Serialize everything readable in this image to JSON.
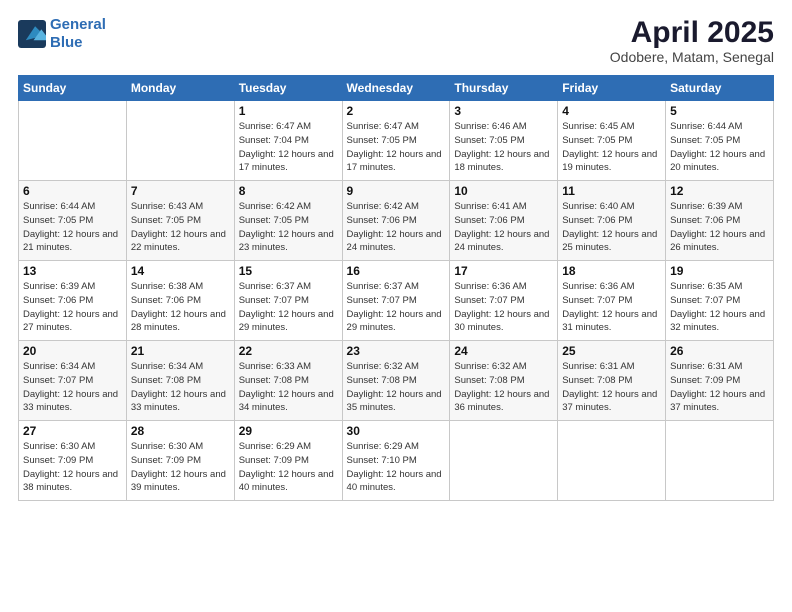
{
  "logo": {
    "line1": "General",
    "line2": "Blue"
  },
  "title": "April 2025",
  "subtitle": "Odobere, Matam, Senegal",
  "weekdays": [
    "Sunday",
    "Monday",
    "Tuesday",
    "Wednesday",
    "Thursday",
    "Friday",
    "Saturday"
  ],
  "weeks": [
    [
      null,
      null,
      {
        "day": "1",
        "sunrise": "6:47 AM",
        "sunset": "7:04 PM",
        "daylight": "12 hours and 17 minutes."
      },
      {
        "day": "2",
        "sunrise": "6:47 AM",
        "sunset": "7:05 PM",
        "daylight": "12 hours and 17 minutes."
      },
      {
        "day": "3",
        "sunrise": "6:46 AM",
        "sunset": "7:05 PM",
        "daylight": "12 hours and 18 minutes."
      },
      {
        "day": "4",
        "sunrise": "6:45 AM",
        "sunset": "7:05 PM",
        "daylight": "12 hours and 19 minutes."
      },
      {
        "day": "5",
        "sunrise": "6:44 AM",
        "sunset": "7:05 PM",
        "daylight": "12 hours and 20 minutes."
      }
    ],
    [
      {
        "day": "6",
        "sunrise": "6:44 AM",
        "sunset": "7:05 PM",
        "daylight": "12 hours and 21 minutes."
      },
      {
        "day": "7",
        "sunrise": "6:43 AM",
        "sunset": "7:05 PM",
        "daylight": "12 hours and 22 minutes."
      },
      {
        "day": "8",
        "sunrise": "6:42 AM",
        "sunset": "7:05 PM",
        "daylight": "12 hours and 23 minutes."
      },
      {
        "day": "9",
        "sunrise": "6:42 AM",
        "sunset": "7:06 PM",
        "daylight": "12 hours and 24 minutes."
      },
      {
        "day": "10",
        "sunrise": "6:41 AM",
        "sunset": "7:06 PM",
        "daylight": "12 hours and 24 minutes."
      },
      {
        "day": "11",
        "sunrise": "6:40 AM",
        "sunset": "7:06 PM",
        "daylight": "12 hours and 25 minutes."
      },
      {
        "day": "12",
        "sunrise": "6:39 AM",
        "sunset": "7:06 PM",
        "daylight": "12 hours and 26 minutes."
      }
    ],
    [
      {
        "day": "13",
        "sunrise": "6:39 AM",
        "sunset": "7:06 PM",
        "daylight": "12 hours and 27 minutes."
      },
      {
        "day": "14",
        "sunrise": "6:38 AM",
        "sunset": "7:06 PM",
        "daylight": "12 hours and 28 minutes."
      },
      {
        "day": "15",
        "sunrise": "6:37 AM",
        "sunset": "7:07 PM",
        "daylight": "12 hours and 29 minutes."
      },
      {
        "day": "16",
        "sunrise": "6:37 AM",
        "sunset": "7:07 PM",
        "daylight": "12 hours and 29 minutes."
      },
      {
        "day": "17",
        "sunrise": "6:36 AM",
        "sunset": "7:07 PM",
        "daylight": "12 hours and 30 minutes."
      },
      {
        "day": "18",
        "sunrise": "6:36 AM",
        "sunset": "7:07 PM",
        "daylight": "12 hours and 31 minutes."
      },
      {
        "day": "19",
        "sunrise": "6:35 AM",
        "sunset": "7:07 PM",
        "daylight": "12 hours and 32 minutes."
      }
    ],
    [
      {
        "day": "20",
        "sunrise": "6:34 AM",
        "sunset": "7:07 PM",
        "daylight": "12 hours and 33 minutes."
      },
      {
        "day": "21",
        "sunrise": "6:34 AM",
        "sunset": "7:08 PM",
        "daylight": "12 hours and 33 minutes."
      },
      {
        "day": "22",
        "sunrise": "6:33 AM",
        "sunset": "7:08 PM",
        "daylight": "12 hours and 34 minutes."
      },
      {
        "day": "23",
        "sunrise": "6:32 AM",
        "sunset": "7:08 PM",
        "daylight": "12 hours and 35 minutes."
      },
      {
        "day": "24",
        "sunrise": "6:32 AM",
        "sunset": "7:08 PM",
        "daylight": "12 hours and 36 minutes."
      },
      {
        "day": "25",
        "sunrise": "6:31 AM",
        "sunset": "7:08 PM",
        "daylight": "12 hours and 37 minutes."
      },
      {
        "day": "26",
        "sunrise": "6:31 AM",
        "sunset": "7:09 PM",
        "daylight": "12 hours and 37 minutes."
      }
    ],
    [
      {
        "day": "27",
        "sunrise": "6:30 AM",
        "sunset": "7:09 PM",
        "daylight": "12 hours and 38 minutes."
      },
      {
        "day": "28",
        "sunrise": "6:30 AM",
        "sunset": "7:09 PM",
        "daylight": "12 hours and 39 minutes."
      },
      {
        "day": "29",
        "sunrise": "6:29 AM",
        "sunset": "7:09 PM",
        "daylight": "12 hours and 40 minutes."
      },
      {
        "day": "30",
        "sunrise": "6:29 AM",
        "sunset": "7:10 PM",
        "daylight": "12 hours and 40 minutes."
      },
      null,
      null,
      null
    ]
  ]
}
